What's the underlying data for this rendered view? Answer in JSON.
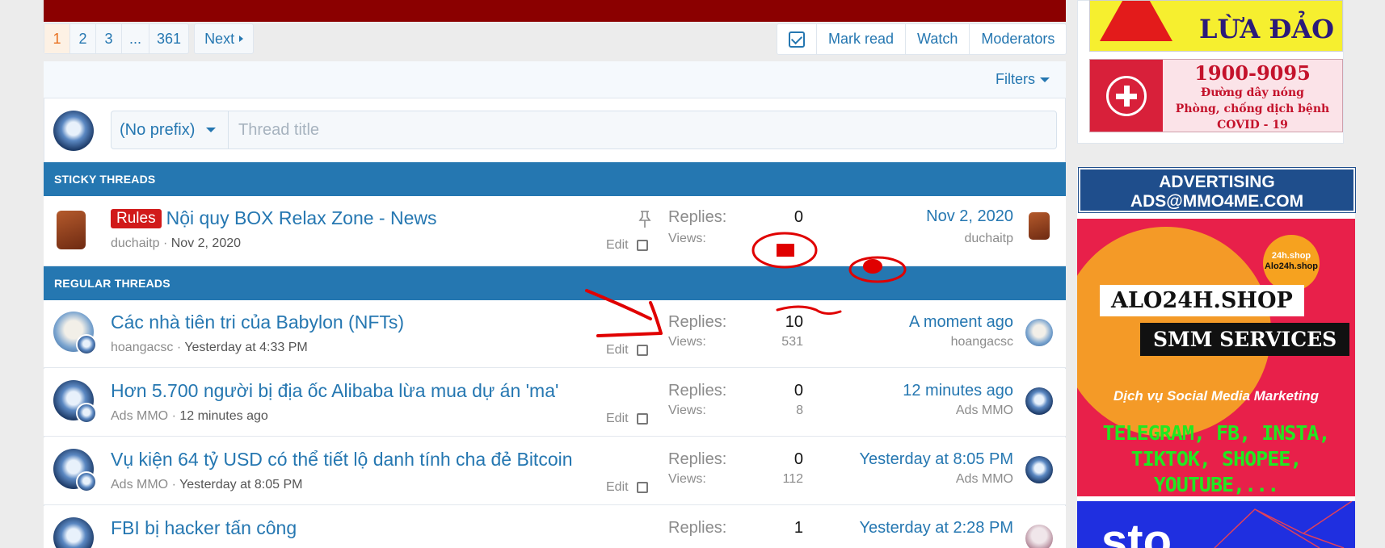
{
  "pagination": {
    "pages": [
      "1",
      "2",
      "3",
      "...",
      "361"
    ],
    "current": "1",
    "next_label": "Next"
  },
  "actions": {
    "select_icon": "checkbox-icon",
    "mark_read": "Mark read",
    "watch": "Watch",
    "moderators": "Moderators"
  },
  "filters_label": "Filters",
  "new_thread": {
    "prefix": "(No prefix)",
    "title_placeholder": "Thread title"
  },
  "sections": {
    "sticky": "STICKY THREADS",
    "regular": "REGULAR THREADS"
  },
  "labels": {
    "replies": "Replies:",
    "views": "Views:",
    "edit": "Edit"
  },
  "sticky_threads": [
    {
      "badge": "Rules",
      "title": "Nội quy BOX Relax Zone - News",
      "author": "duchaitp",
      "date": "Nov 2, 2020",
      "replies": "0",
      "views": "",
      "last_date": "Nov 2, 2020",
      "last_user": "duchaitp"
    }
  ],
  "regular_threads": [
    {
      "title": "Các nhà tiên tri của Babylon (NFTs)",
      "author": "hoangacsc",
      "date": "Yesterday at 4:33 PM",
      "replies": "10",
      "views": "531",
      "last_date": "A moment ago",
      "last_user": "hoangacsc"
    },
    {
      "title": "Hơn 5.700 người bị địa ốc Alibaba lừa mua dự án 'ma'",
      "author": "Ads MMO",
      "date": "12 minutes ago",
      "replies": "0",
      "views": "8",
      "last_date": "12 minutes ago",
      "last_user": "Ads MMO"
    },
    {
      "title": "Vụ kiện 64 tỷ USD có thể tiết lộ danh tính cha đẻ Bitcoin",
      "author": "Ads MMO",
      "date": "Yesterday at 8:05 PM",
      "replies": "0",
      "views": "112",
      "last_date": "Yesterday at 8:05 PM",
      "last_user": "Ads MMO"
    },
    {
      "title": "FBI bị hacker tấn công",
      "author": "",
      "date": "",
      "replies": "1",
      "views": "",
      "last_date": "Yesterday at 2:28 PM",
      "last_user": ""
    }
  ],
  "sidebar": {
    "warning_text": "LỪA ĐẢO",
    "hotline_number": "1900-9095",
    "hotline_line1": "Đường dây nóng",
    "hotline_line2": "Phòng, chống dịch bệnh",
    "hotline_line3": "COVID - 19",
    "ad_head_line1": "ADVERTISING",
    "ad_head_line2": "ADS@MMO4ME.COM",
    "ad_circle_line1": "24h.shop",
    "ad_circle_line2": "Alo24h.shop",
    "ad_label1": "ALO24H.SHOP",
    "ad_label2": "SMM SERVICES",
    "ad_sub": "Dịch vụ Social Media Marketing",
    "ad_green1": "TELEGRAM, FB, INSTA,",
    "ad_green2": "TIKTOK, SHOPEE, YOUTUBE,...",
    "ad_blue_text": "sto"
  },
  "colors": {
    "accent": "#2577b1",
    "section_bar": "#2577b1",
    "badge_red": "#d11a1a",
    "annotation_red": "#e00000"
  }
}
